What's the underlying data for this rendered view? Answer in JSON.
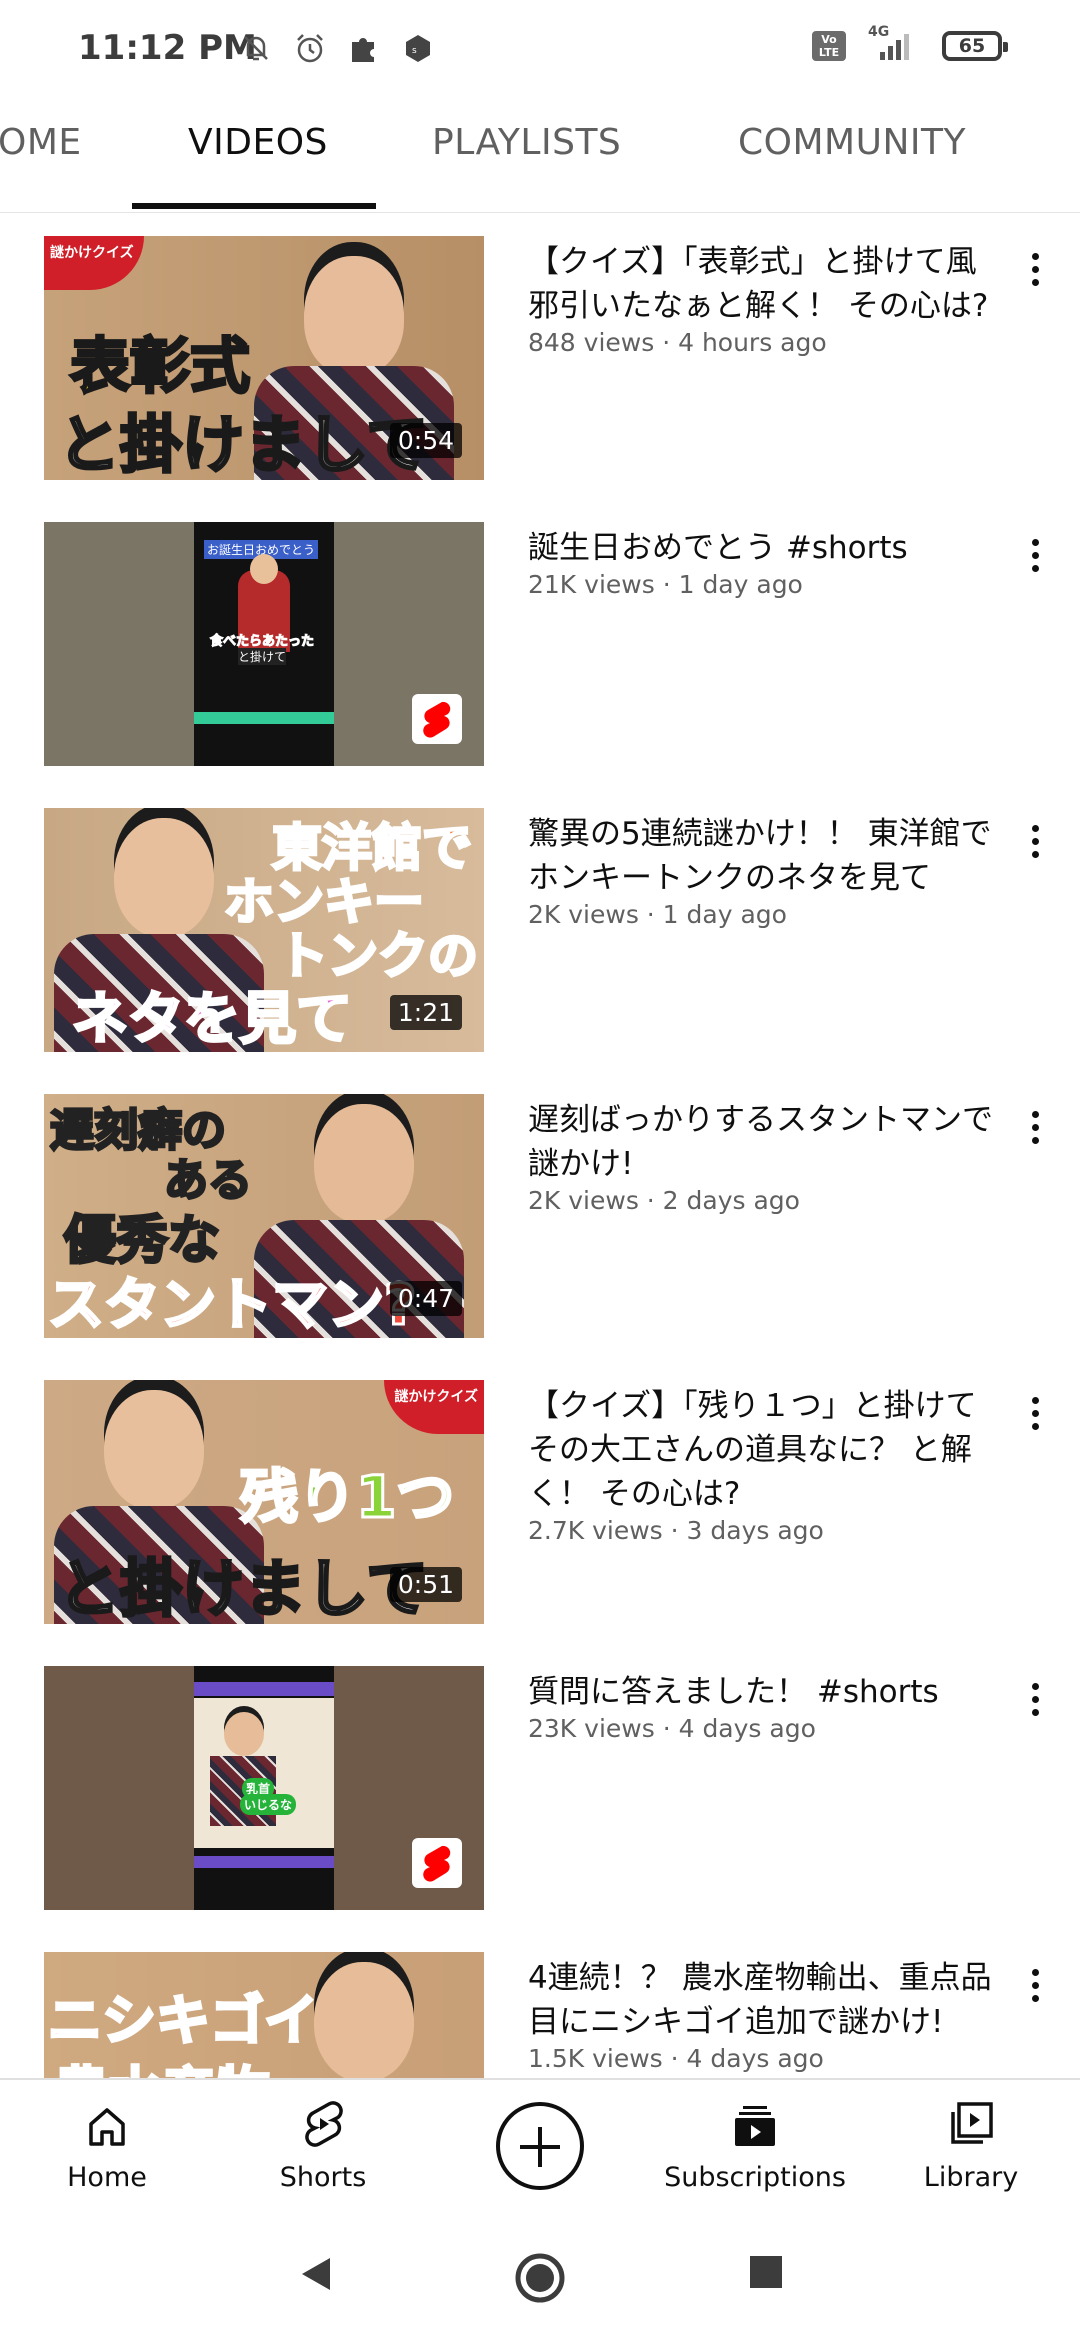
{
  "status_bar": {
    "time": "11:12 PM",
    "volte": "Vo LTE",
    "network": "4G",
    "battery": "65"
  },
  "tabs": [
    {
      "label": "HOME",
      "display": "OME"
    },
    {
      "label": "VIDEOS"
    },
    {
      "label": "PLAYLISTS"
    },
    {
      "label": "COMMUNITY"
    }
  ],
  "active_tab": "VIDEOS",
  "videos": [
    {
      "title": "【クイズ】「表彰式」と掛けて風邪引いたなぁと解く！ その心は?",
      "meta": "848 views · 4 hours ago",
      "duration": "0:54",
      "thumb_text": [
        "表彰式",
        "と掛けまして"
      ],
      "badge": "謎かけクイズ"
    },
    {
      "title": "誕生日おめでとう #shorts",
      "meta": "21K views · 1 day ago",
      "short": true,
      "thumb_text": [
        "お誕生日おめでとう",
        "食べたらあたった",
        "と掛けて"
      ]
    },
    {
      "title": "驚異の5連続謎かけ！！ 東洋館でホンキートンクのネタを見て",
      "meta": "2K views · 1 day ago",
      "duration": "1:21",
      "thumb_text": [
        "東洋館で",
        "ホンキー",
        "トンクの",
        "ネタを見て"
      ]
    },
    {
      "title": "遅刻ばっかりするスタントマンで謎かけ!",
      "meta": "2K views · 2 days ago",
      "duration": "0:47",
      "thumb_text": [
        "遅刻癖の",
        "ある",
        "優秀な",
        "スタントマン?"
      ]
    },
    {
      "title": "【クイズ】「残り１つ」と掛けてその大工さんの道具なに？ と解く！ その心は?",
      "meta": "2.7K views · 3 days ago",
      "duration": "0:51",
      "thumb_text": [
        "残り1つ",
        "と掛けまして"
      ],
      "badge": "謎かけクイズ"
    },
    {
      "title": "質問に答えました！ #shorts",
      "meta": "23K views · 4 days ago",
      "short": true,
      "thumb_text": [
        "乳首",
        "いじるな"
      ]
    },
    {
      "title": "4連続！？ 農水産物輸出、重点品目にニシキゴイ追加で謎かけ!",
      "meta": "1.5K views · 4 days ago",
      "thumb_text": [
        "ニシキゴイ",
        "農水産物"
      ]
    }
  ],
  "bottom_nav": {
    "home": "Home",
    "shorts": "Shorts",
    "subscriptions": "Subscriptions",
    "library": "Library"
  },
  "colors": {
    "text": "#0f0f0f",
    "secondary": "#606060",
    "shorts_red": "#ff0000"
  }
}
